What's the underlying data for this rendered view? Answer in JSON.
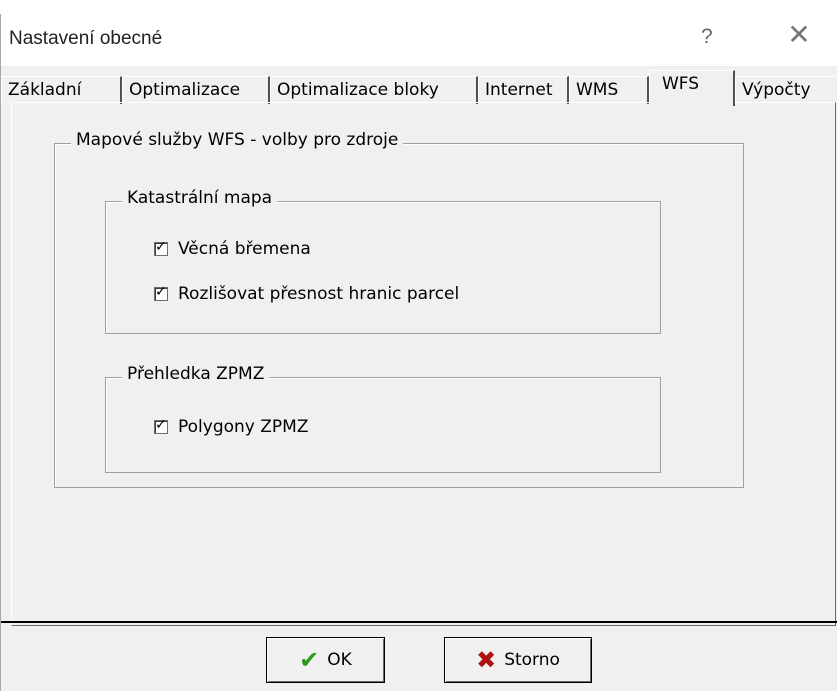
{
  "window": {
    "title": "Nastavení obecné",
    "help_label": "?",
    "close_label": "✕"
  },
  "tabs": [
    {
      "label": "Základní",
      "active": false
    },
    {
      "label": "Optimalizace",
      "active": false
    },
    {
      "label": "Optimalizace bloky",
      "active": false
    },
    {
      "label": "Internet",
      "active": false
    },
    {
      "label": "WMS",
      "active": false
    },
    {
      "label": "WFS",
      "active": true
    },
    {
      "label": "Výpočty",
      "active": false
    }
  ],
  "panel": {
    "outer_group_title": "Mapové služby WFS - volby pro zdroje",
    "katastralni": {
      "title": "Katastrální mapa",
      "items": [
        {
          "label": "Věcná břemena",
          "checked": true
        },
        {
          "label": "Rozlišovat přesnost hranic parcel",
          "checked": true
        }
      ]
    },
    "prehledka": {
      "title": "Přehledka ZPMZ",
      "items": [
        {
          "label": "Polygony ZPMZ",
          "checked": true
        }
      ]
    }
  },
  "buttons": {
    "ok_label": "OK",
    "ok_icon": "✔",
    "ok_icon_color": "#2e9a1d",
    "cancel_label": "Storno",
    "cancel_icon": "✖",
    "cancel_icon_color": "#b01010"
  }
}
